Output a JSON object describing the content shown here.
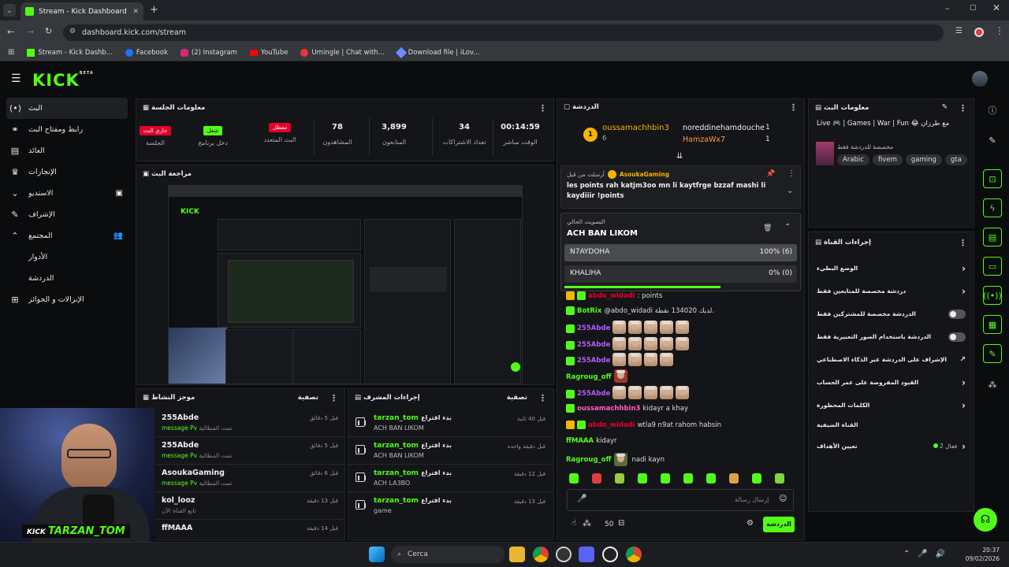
{
  "browser": {
    "tab_title": "Stream - Kick Dashboard",
    "url": "dashboard.kick.com/stream",
    "bookmarks": [
      "Stream - Kick Dashb...",
      "Facebook",
      "(2) Instagram",
      "YouTube",
      "Umingle | Chat with...",
      "Download file | iLov..."
    ]
  },
  "header": {
    "logo": "KICK",
    "beta": "BETA"
  },
  "sidebar": {
    "items": [
      {
        "label": "البث",
        "icon": "live-icon"
      },
      {
        "label": "رابط ومفتاح البث",
        "icon": "link-icon"
      },
      {
        "label": "العائد",
        "icon": "money-icon"
      },
      {
        "label": "الإنجازات",
        "icon": "trophy-icon"
      },
      {
        "label": "الاستديو",
        "icon": "chevron-down-icon"
      },
      {
        "label": "الإشراف",
        "icon": "wrench-icon"
      },
      {
        "label": "المجتمع",
        "icon": "chevron-up-icon"
      },
      {
        "label": "الأدوار",
        "icon": ""
      },
      {
        "label": "الدردشة",
        "icon": ""
      },
      {
        "label": "الإنزالات و الجوائز",
        "icon": "gift-icon"
      }
    ]
  },
  "session": {
    "title": "معلومات الجلسة",
    "stats": [
      {
        "value": "00:14:59",
        "label": "الوقت مباشر"
      },
      {
        "value": "34",
        "label": "تعداد الاشتراكات"
      },
      {
        "value": "3,899",
        "label": "المتابعون"
      },
      {
        "value": "78",
        "label": "المشاهدون"
      },
      {
        "pill": "معطل",
        "label": "البث المتعدد",
        "color": "#e5002b"
      },
      {
        "pill": "شغل",
        "label": "دخل برنامج",
        "color": "#53fc18"
      },
      {
        "pill": "جاري البث",
        "label": "الجلسة",
        "color": "#e5002b"
      }
    ]
  },
  "preview": {
    "title": "مراجعة البث"
  },
  "activity": {
    "title": "موجز النشاط",
    "filter": "تصفية",
    "rows": [
      {
        "name": "255Abde",
        "time": "قبل 5 دقائق",
        "sub": "تمت المطالبة",
        "action": "message Pv"
      },
      {
        "name": "255Abde",
        "time": "قبل 5 دقائق",
        "sub": "تمت المطالبة",
        "action": "message Pv"
      },
      {
        "name": "AsoukaGaming",
        "time": "قبل 6 دقائق",
        "sub": "تمت المطالبة",
        "action": "message Pv"
      },
      {
        "name": "kol_looz",
        "time": "قبل 13 دقيقة",
        "sub": "تابع القناة الآن",
        "action": ""
      },
      {
        "name": "ffMAAA",
        "time": "قبل 14 دقيقة",
        "sub": "",
        "action": ""
      }
    ]
  },
  "modactions": {
    "title": "إجراءات المشرف",
    "filter": "تصفية",
    "rows": [
      {
        "user": "tarzan_tom",
        "action": "بدء اقتراع",
        "time": "قبل 40 ثانية",
        "text": "ACH BAN LIKOM"
      },
      {
        "user": "tarzan_tom",
        "action": "بدء اقتراع",
        "time": "قبل دقيقة واحدة",
        "text": "ACH BAN LIKOM"
      },
      {
        "user": "tarzan_tom",
        "action": "بدء اقتراع",
        "time": "قبل 12 دقيقة",
        "text": "ACH LA3BO"
      },
      {
        "user": "tarzan_tom",
        "action": "بدء اقتراع",
        "time": "قبل 13 دقيقة",
        "text": "game"
      }
    ]
  },
  "chat": {
    "title": "الدردشة",
    "leaders": [
      {
        "rank": "1",
        "name": "oussamachhbin3",
        "count": "6"
      },
      {
        "name": "noreddinehamdouche",
        "count": "1"
      },
      {
        "name": "HamzaWx7",
        "count": "1"
      }
    ],
    "pinned": {
      "by": "أرسلت من قبل",
      "user": "AsoukaGaming",
      "text": "les points rah katjm3oo mn li kaytfrge bzzaf mashi li kaydiiir !points"
    },
    "poll": {
      "label": "التصويت الحالي",
      "question": "ACH BAN LIKOM",
      "options": [
        {
          "name": "N7AYDOHA",
          "result": "100% (6)",
          "fraction": 1.0
        },
        {
          "name": "KHALIHA",
          "result": "0% (0)",
          "fraction": 0.0
        }
      ]
    },
    "messages": [
      {
        "user": "abdo_widadi",
        "text": ": points",
        "color": "#e5002b"
      },
      {
        "user": "BotRix",
        "text": "@abdo_widadi لديك 134020 نقطة.",
        "color": "#53fc18"
      },
      {
        "user": "255Abde",
        "text": "",
        "color": "#b05cff"
      },
      {
        "user": "255Abde",
        "text": "",
        "color": "#b05cff"
      },
      {
        "user": "255Abde",
        "text": "",
        "color": "#b05cff"
      },
      {
        "user": "Ragroug_off",
        "text": "",
        "color": "#53fc18"
      },
      {
        "user": "255Abde",
        "text": "",
        "color": "#b05cff"
      },
      {
        "user": "oussamachhbin3",
        "text": "kidayr a khay",
        "color": "#ff5cc4"
      },
      {
        "user": "abdo_widadi",
        "text": "wtla9 n9at rahom habsin",
        "color": "#e5002b"
      },
      {
        "user": "ffMAAA",
        "text": "kidayr",
        "color": "#53fc18"
      },
      {
        "user": "Ragroug_off",
        "text": "nadi kayn",
        "color": "#53fc18"
      }
    ],
    "input_placeholder": "إرسال رسالة",
    "points": "50",
    "send": "الدردشة"
  },
  "streaminfo": {
    "title": "معلومات البث",
    "stream_title": "Live 🎮 | Games | War | Fun 😂 مع طرزان",
    "sub": "مخصصة للدردشة فقط",
    "tags": [
      "Arabic",
      "fivem",
      "gaming",
      "gta"
    ]
  },
  "channel": {
    "title": "إجراءات القناة",
    "rows": [
      {
        "label": "الوضع البطيء",
        "kind": "arrow"
      },
      {
        "label": "دردشة مخصصة للمتابعين فقط",
        "kind": "arrow"
      },
      {
        "label": "الدردشة مخصصة للمشتركين فقط",
        "kind": "toggle"
      },
      {
        "label": "الدردشة باستخدام الصور التعبيرية فقط",
        "kind": "toggle"
      },
      {
        "label": "الإشراف على الدردشة عبر الذكاء الاصطناعي",
        "kind": "ext"
      },
      {
        "label": "القيود المفروضة على عمر الحساب",
        "kind": "arrow"
      },
      {
        "label": "الكلمات المحظورة",
        "kind": "arrow"
      }
    ],
    "guest_title": "القناة الضيفية",
    "goals": "تعيين الأهداف",
    "goals_status": "فعال 2"
  },
  "webcam": {
    "name": "TARZAN_TOM"
  },
  "taskbar": {
    "search": "Cerca",
    "time": "20:37",
    "date": "09/02/2026"
  }
}
